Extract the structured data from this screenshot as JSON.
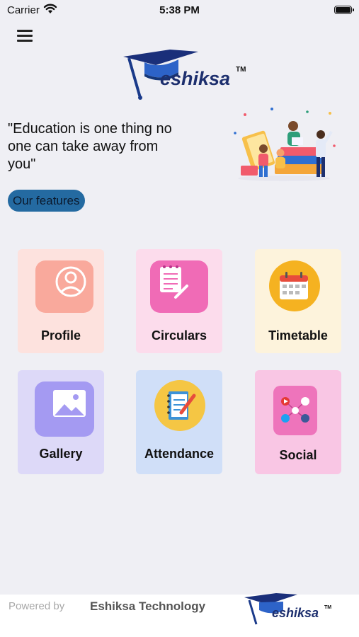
{
  "status_bar": {
    "carrier": "Carrier",
    "time": "5:38 PM"
  },
  "header": {
    "logo_text": "eshiksa",
    "logo_tm": "TM",
    "menu_icon": "hamburger-menu-icon"
  },
  "hero": {
    "quote": "\"Education is one thing no one can take away from you\"",
    "features_button": "Our features"
  },
  "cards": [
    {
      "label": "Profile",
      "icon": "user-profile-icon",
      "bg": "#fde2de",
      "icon_bg": "#f9a99c"
    },
    {
      "label": "Circulars",
      "icon": "notepad-icon",
      "bg": "#fcdcec",
      "icon_bg": "#f06bb6"
    },
    {
      "label": "Timetable",
      "icon": "calendar-icon",
      "bg": "#fdf3dc",
      "icon_bg": "#f5b221"
    },
    {
      "label": "Gallery",
      "icon": "image-gallery-icon",
      "bg": "#ddd9f8",
      "icon_bg": "#a49af2"
    },
    {
      "label": "Attendance",
      "icon": "notebook-pencil-icon",
      "bg": "#d0dff8",
      "icon_bg": "#f5c644"
    },
    {
      "label": "Social",
      "icon": "social-media-icon",
      "bg": "#f9c6e4",
      "icon_bg": "#ee74bb"
    }
  ],
  "footer": {
    "powered_by": "Powered by",
    "company": "Eshiksa Technology",
    "logo_text": "eshiksa",
    "logo_tm": "TM"
  },
  "colors": {
    "background": "#efeff4",
    "features_button": "#246aa1",
    "logo_blue": "#1d3f8c"
  }
}
